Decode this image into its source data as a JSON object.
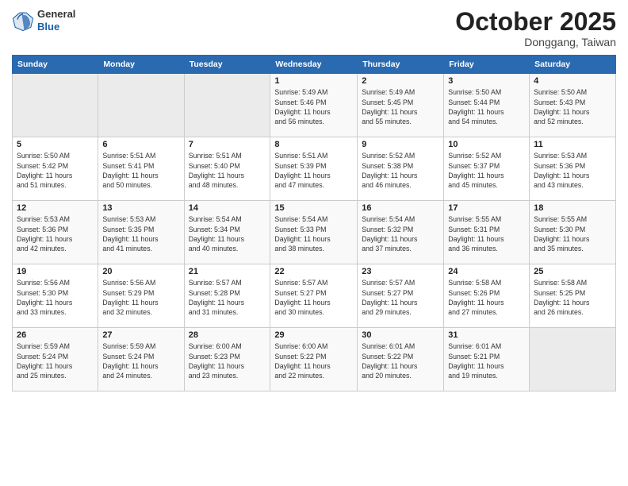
{
  "header": {
    "logo": {
      "general": "General",
      "blue": "Blue"
    },
    "title": "October 2025",
    "location": "Donggang, Taiwan"
  },
  "weekdays": [
    "Sunday",
    "Monday",
    "Tuesday",
    "Wednesday",
    "Thursday",
    "Friday",
    "Saturday"
  ],
  "weeks": [
    [
      {
        "day": "",
        "info": ""
      },
      {
        "day": "",
        "info": ""
      },
      {
        "day": "",
        "info": ""
      },
      {
        "day": "1",
        "info": "Sunrise: 5:49 AM\nSunset: 5:46 PM\nDaylight: 11 hours\nand 56 minutes."
      },
      {
        "day": "2",
        "info": "Sunrise: 5:49 AM\nSunset: 5:45 PM\nDaylight: 11 hours\nand 55 minutes."
      },
      {
        "day": "3",
        "info": "Sunrise: 5:50 AM\nSunset: 5:44 PM\nDaylight: 11 hours\nand 54 minutes."
      },
      {
        "day": "4",
        "info": "Sunrise: 5:50 AM\nSunset: 5:43 PM\nDaylight: 11 hours\nand 52 minutes."
      }
    ],
    [
      {
        "day": "5",
        "info": "Sunrise: 5:50 AM\nSunset: 5:42 PM\nDaylight: 11 hours\nand 51 minutes."
      },
      {
        "day": "6",
        "info": "Sunrise: 5:51 AM\nSunset: 5:41 PM\nDaylight: 11 hours\nand 50 minutes."
      },
      {
        "day": "7",
        "info": "Sunrise: 5:51 AM\nSunset: 5:40 PM\nDaylight: 11 hours\nand 48 minutes."
      },
      {
        "day": "8",
        "info": "Sunrise: 5:51 AM\nSunset: 5:39 PM\nDaylight: 11 hours\nand 47 minutes."
      },
      {
        "day": "9",
        "info": "Sunrise: 5:52 AM\nSunset: 5:38 PM\nDaylight: 11 hours\nand 46 minutes."
      },
      {
        "day": "10",
        "info": "Sunrise: 5:52 AM\nSunset: 5:37 PM\nDaylight: 11 hours\nand 45 minutes."
      },
      {
        "day": "11",
        "info": "Sunrise: 5:53 AM\nSunset: 5:36 PM\nDaylight: 11 hours\nand 43 minutes."
      }
    ],
    [
      {
        "day": "12",
        "info": "Sunrise: 5:53 AM\nSunset: 5:36 PM\nDaylight: 11 hours\nand 42 minutes."
      },
      {
        "day": "13",
        "info": "Sunrise: 5:53 AM\nSunset: 5:35 PM\nDaylight: 11 hours\nand 41 minutes."
      },
      {
        "day": "14",
        "info": "Sunrise: 5:54 AM\nSunset: 5:34 PM\nDaylight: 11 hours\nand 40 minutes."
      },
      {
        "day": "15",
        "info": "Sunrise: 5:54 AM\nSunset: 5:33 PM\nDaylight: 11 hours\nand 38 minutes."
      },
      {
        "day": "16",
        "info": "Sunrise: 5:54 AM\nSunset: 5:32 PM\nDaylight: 11 hours\nand 37 minutes."
      },
      {
        "day": "17",
        "info": "Sunrise: 5:55 AM\nSunset: 5:31 PM\nDaylight: 11 hours\nand 36 minutes."
      },
      {
        "day": "18",
        "info": "Sunrise: 5:55 AM\nSunset: 5:30 PM\nDaylight: 11 hours\nand 35 minutes."
      }
    ],
    [
      {
        "day": "19",
        "info": "Sunrise: 5:56 AM\nSunset: 5:30 PM\nDaylight: 11 hours\nand 33 minutes."
      },
      {
        "day": "20",
        "info": "Sunrise: 5:56 AM\nSunset: 5:29 PM\nDaylight: 11 hours\nand 32 minutes."
      },
      {
        "day": "21",
        "info": "Sunrise: 5:57 AM\nSunset: 5:28 PM\nDaylight: 11 hours\nand 31 minutes."
      },
      {
        "day": "22",
        "info": "Sunrise: 5:57 AM\nSunset: 5:27 PM\nDaylight: 11 hours\nand 30 minutes."
      },
      {
        "day": "23",
        "info": "Sunrise: 5:57 AM\nSunset: 5:27 PM\nDaylight: 11 hours\nand 29 minutes."
      },
      {
        "day": "24",
        "info": "Sunrise: 5:58 AM\nSunset: 5:26 PM\nDaylight: 11 hours\nand 27 minutes."
      },
      {
        "day": "25",
        "info": "Sunrise: 5:58 AM\nSunset: 5:25 PM\nDaylight: 11 hours\nand 26 minutes."
      }
    ],
    [
      {
        "day": "26",
        "info": "Sunrise: 5:59 AM\nSunset: 5:24 PM\nDaylight: 11 hours\nand 25 minutes."
      },
      {
        "day": "27",
        "info": "Sunrise: 5:59 AM\nSunset: 5:24 PM\nDaylight: 11 hours\nand 24 minutes."
      },
      {
        "day": "28",
        "info": "Sunrise: 6:00 AM\nSunset: 5:23 PM\nDaylight: 11 hours\nand 23 minutes."
      },
      {
        "day": "29",
        "info": "Sunrise: 6:00 AM\nSunset: 5:22 PM\nDaylight: 11 hours\nand 22 minutes."
      },
      {
        "day": "30",
        "info": "Sunrise: 6:01 AM\nSunset: 5:22 PM\nDaylight: 11 hours\nand 20 minutes."
      },
      {
        "day": "31",
        "info": "Sunrise: 6:01 AM\nSunset: 5:21 PM\nDaylight: 11 hours\nand 19 minutes."
      },
      {
        "day": "",
        "info": ""
      }
    ]
  ]
}
